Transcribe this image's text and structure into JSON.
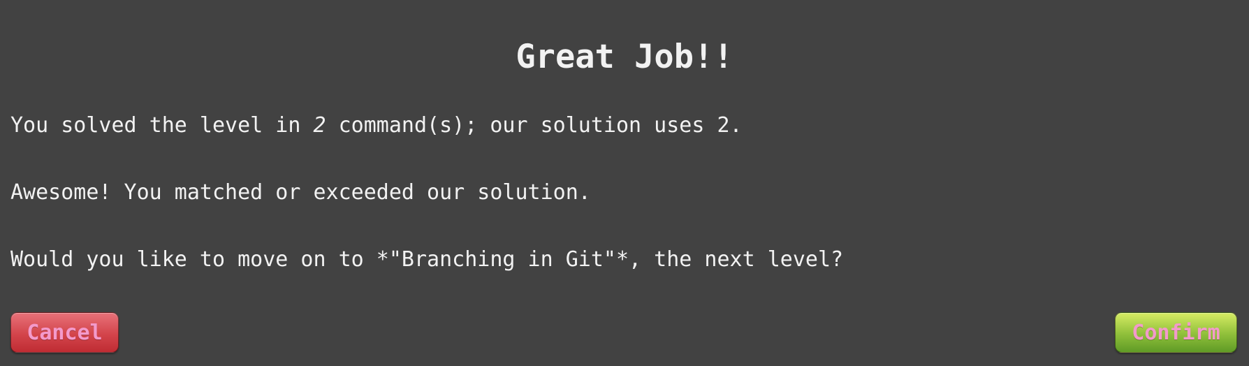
{
  "dialog": {
    "title": "Great Job!!",
    "line1_prefix": "You solved the level in ",
    "line1_user_count": "2",
    "line1_suffix": " command(s); our solution uses 2.",
    "line2": "Awesome! You matched or exceeded our solution.",
    "line3": "Would you like to move on to *\"Branching in Git\"*, the next level?"
  },
  "buttons": {
    "cancel_label": "Cancel",
    "confirm_label": "Confirm"
  },
  "colors": {
    "background": "#424242",
    "text": "#f2f2f2",
    "button_text": "#f39acb",
    "cancel": "#d3444b",
    "confirm": "#8fbf3a"
  }
}
